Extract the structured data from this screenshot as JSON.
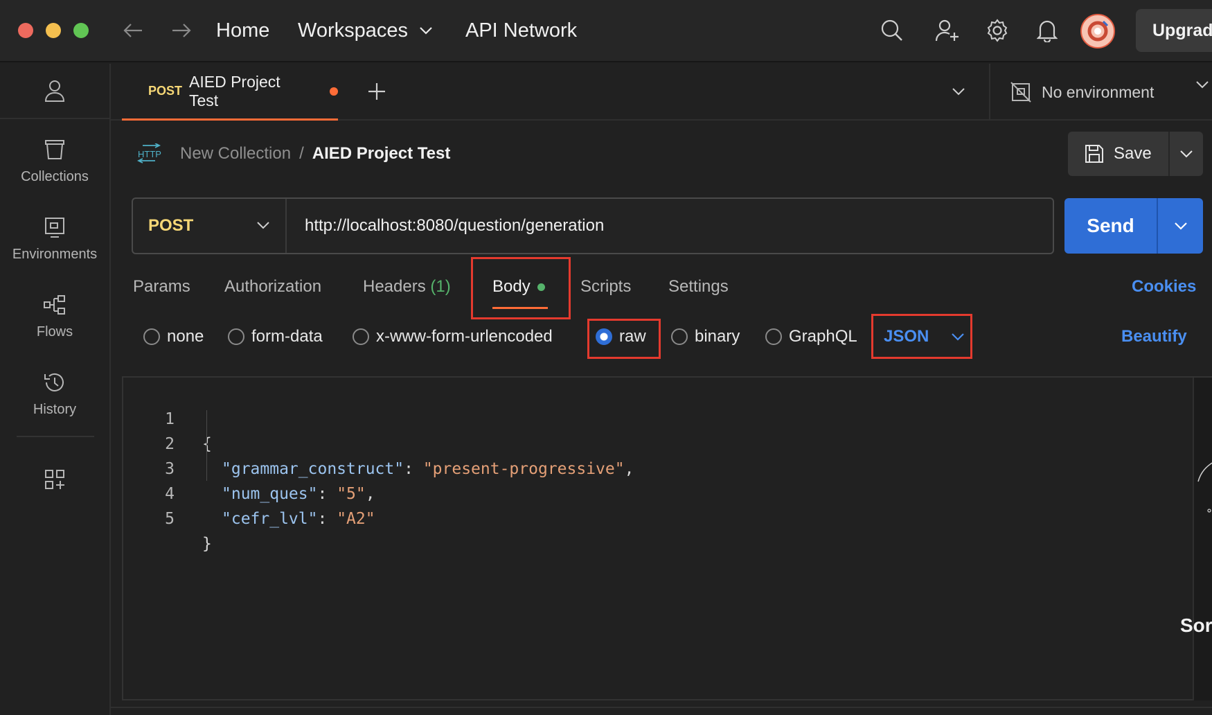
{
  "titlebar": {
    "nav": [
      "Home",
      "Workspaces",
      "API Network"
    ],
    "upgrade_label": "Upgrad"
  },
  "sidebar": {
    "items": [
      {
        "label": "Collections",
        "icon": "collections-icon"
      },
      {
        "label": "Environments",
        "icon": "environments-icon"
      },
      {
        "label": "Flows",
        "icon": "flows-icon"
      },
      {
        "label": "History",
        "icon": "history-icon"
      }
    ]
  },
  "tab": {
    "method": "POST",
    "name": "AIED Project Test"
  },
  "environment": {
    "label": "No environment"
  },
  "breadcrumb": {
    "collection": "New Collection",
    "separator": "/",
    "request": "AIED Project Test"
  },
  "save_label": "Save",
  "request": {
    "method": "POST",
    "url": "http://localhost:8080/question/generation",
    "send_label": "Send"
  },
  "request_tabs": {
    "params": "Params",
    "authorization": "Authorization",
    "headers": "Headers",
    "headers_count": "(1)",
    "body": "Body",
    "scripts": "Scripts",
    "settings": "Settings",
    "cookies": "Cookies"
  },
  "body_types": {
    "none": "none",
    "form_data": "form-data",
    "urlencoded": "x-www-form-urlencoded",
    "raw": "raw",
    "binary": "binary",
    "graphql": "GraphQL",
    "selected": "raw",
    "language": "JSON",
    "beautify": "Beautify"
  },
  "editor": {
    "line_numbers": [
      "1",
      "2",
      "3",
      "4",
      "5"
    ],
    "open_brace": "{",
    "close_brace": "}",
    "pairs": [
      {
        "key": "\"grammar_construct\"",
        "value": "\"present-progressive\"",
        "comma": ","
      },
      {
        "key": "\"num_ques\"",
        "value": "\"5\"",
        "comma": ","
      },
      {
        "key": "\"cefr_lvl\"",
        "value": "\"A2\"",
        "comma": ""
      }
    ],
    "colon": ": "
  },
  "side_panel": {
    "cut_text": "Sor"
  },
  "colors": {
    "accent": "#ff6c37",
    "send_blue": "#2f6ed6",
    "link_blue": "#4a8ff2",
    "method_yellow": "#f6d776",
    "highlight_red": "#e43a2e",
    "json_key": "#9cc4ef",
    "json_string": "#e5a077"
  }
}
